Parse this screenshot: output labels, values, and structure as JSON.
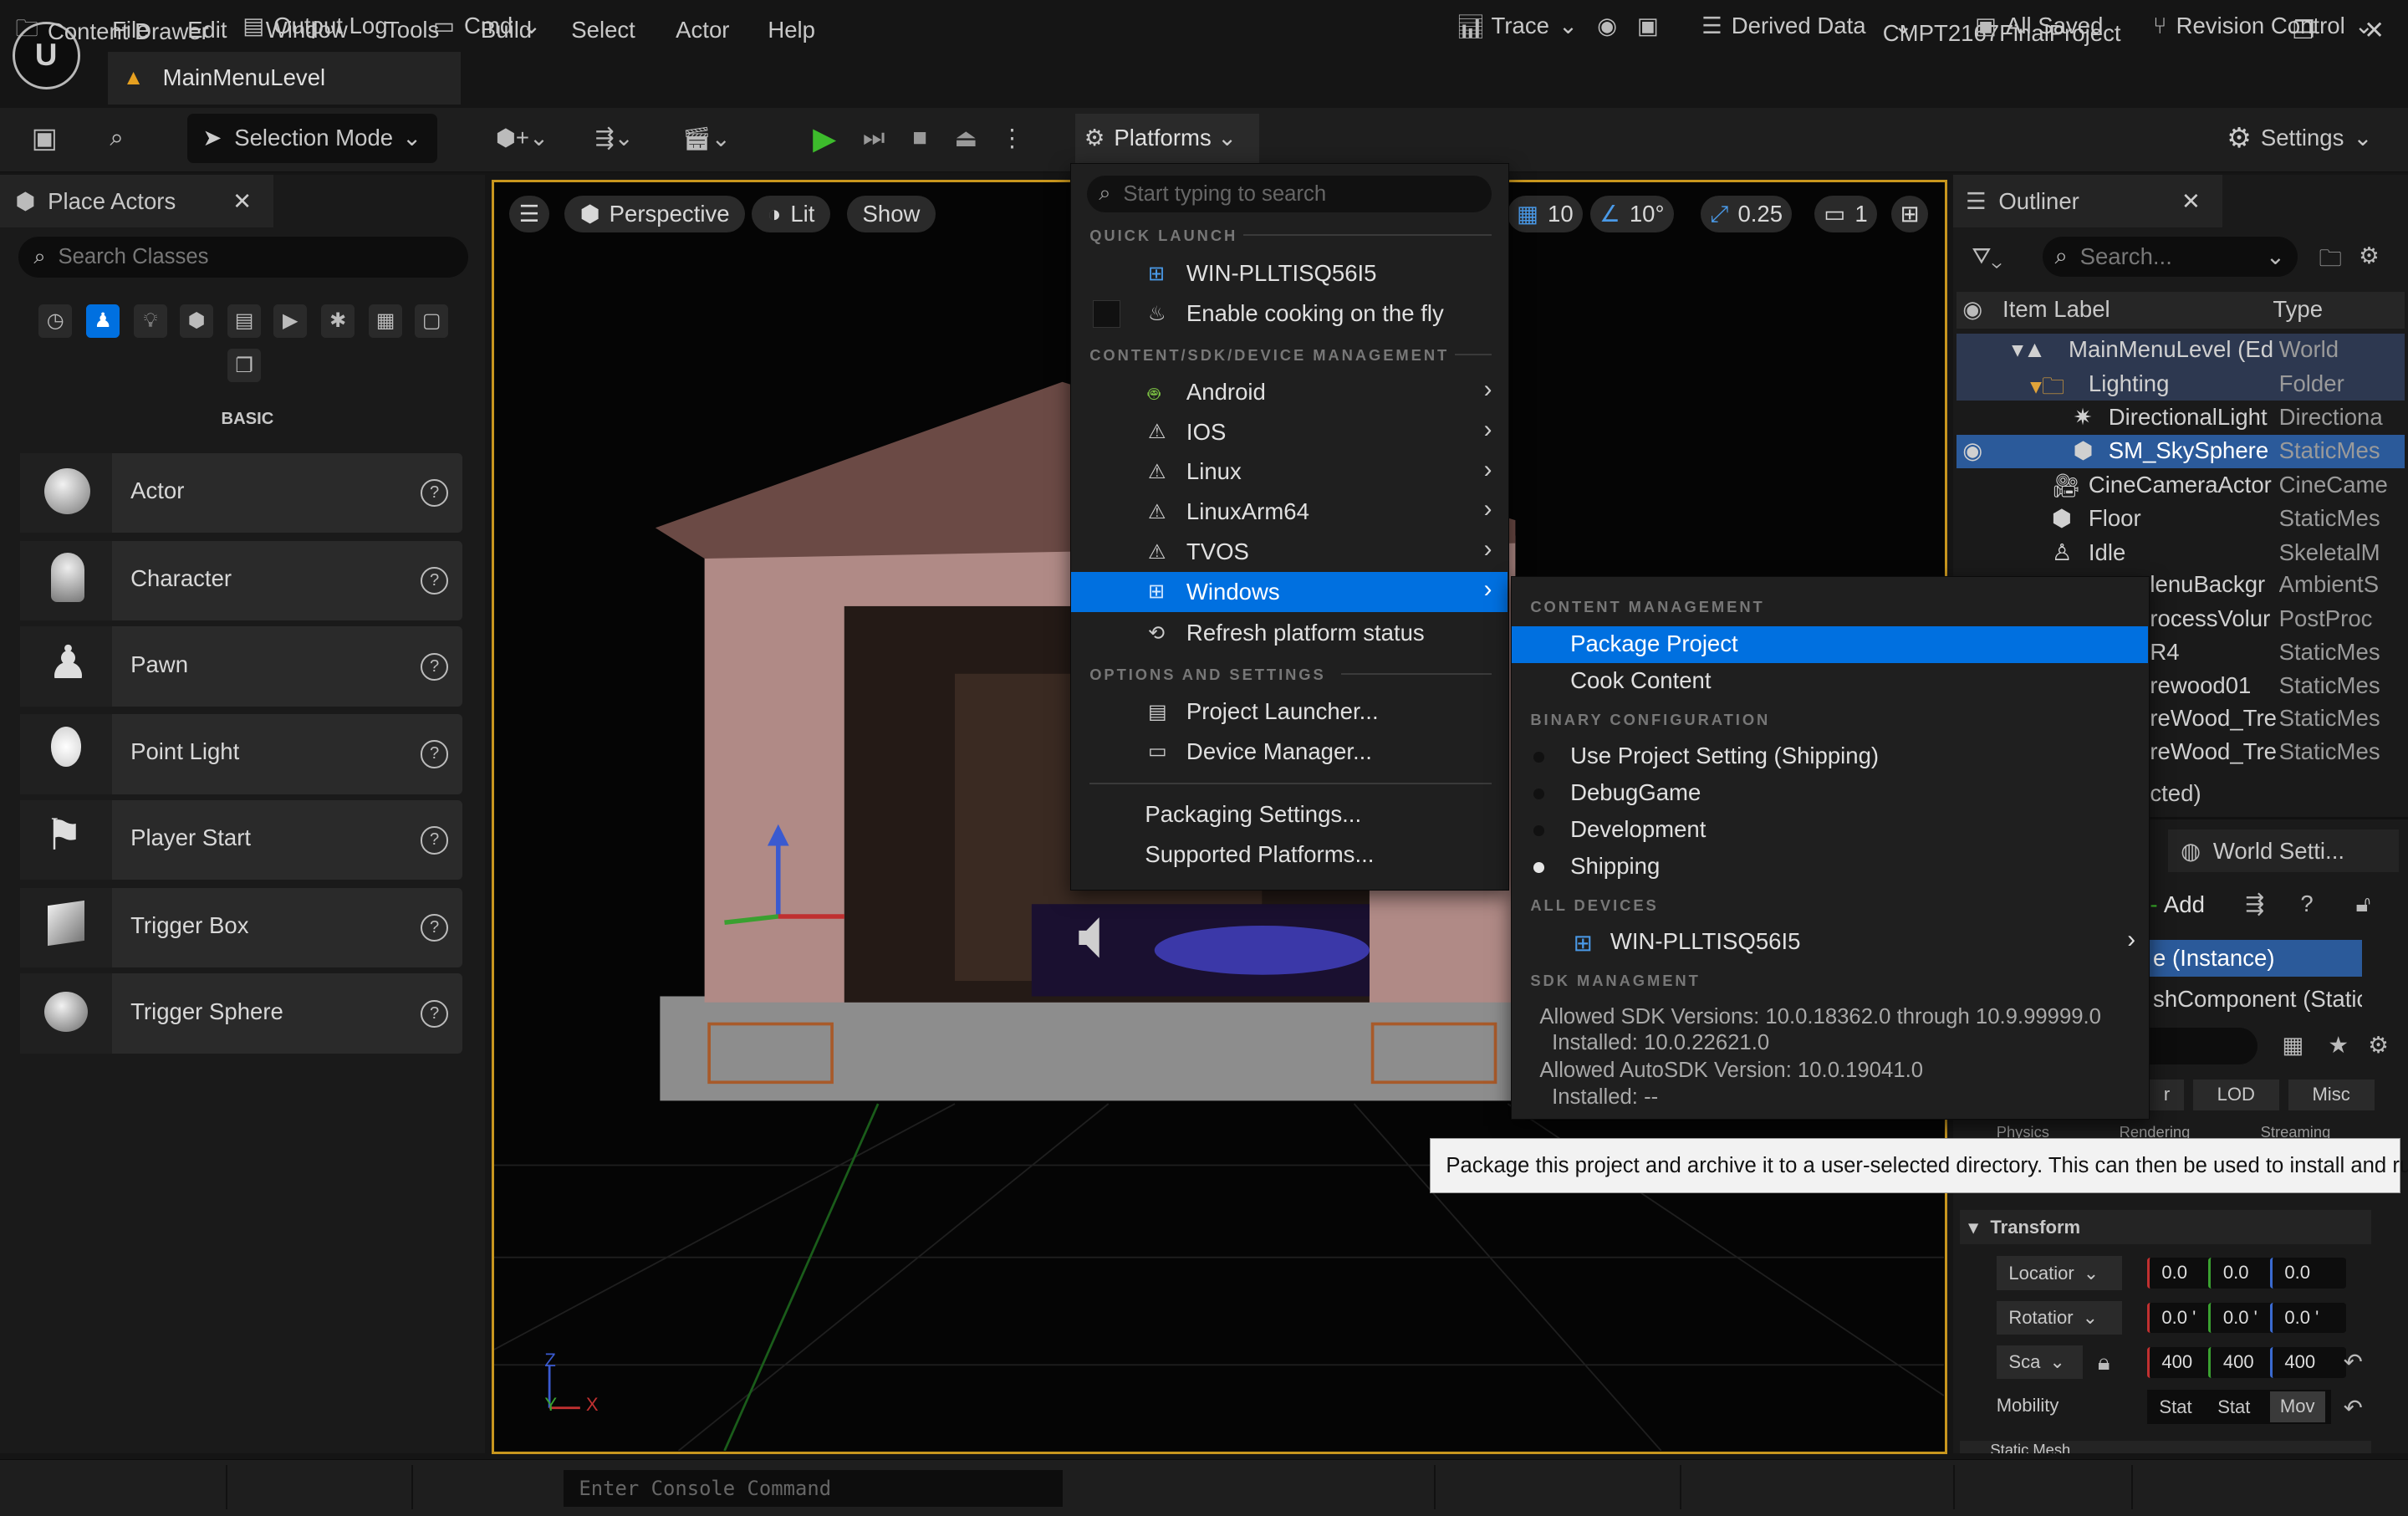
{
  "window": {
    "project_name": "CMPT2167FinalProject",
    "level_tab": "MainMenuLevel",
    "menu": [
      "File",
      "Edit",
      "Window",
      "Tools",
      "Build",
      "Select",
      "Actor",
      "Help"
    ]
  },
  "toolbar": {
    "selection_mode": "Selection Mode",
    "platforms": "Platforms",
    "settings": "Settings"
  },
  "place_actors": {
    "title": "Place Actors",
    "search_placeholder": "Search Classes",
    "category": "BASIC",
    "items": [
      "Actor",
      "Character",
      "Pawn",
      "Point Light",
      "Player Start",
      "Trigger Box",
      "Trigger Sphere"
    ]
  },
  "viewport": {
    "perspective": "Perspective",
    "lit": "Lit",
    "show": "Show",
    "grid_size": "10",
    "rotation_snap": "10°",
    "scale_snap": "0.25",
    "camera_speed": "1",
    "axis_x": "X",
    "axis_y": "Y",
    "axis_z": "Z"
  },
  "outliner": {
    "title": "Outliner",
    "search_placeholder": "Search...",
    "col_label": "Item Label",
    "col_type": "Type",
    "rows": [
      {
        "label": "MainMenuLevel (Ed",
        "type": "World"
      },
      {
        "label": "Lighting",
        "type": "Folder"
      },
      {
        "label": "DirectionalLight",
        "type": "Directiona"
      },
      {
        "label": "SM_SkySphere",
        "type": "StaticMes"
      },
      {
        "label": "CineCameraActor",
        "type": "CineCame"
      },
      {
        "label": "Floor",
        "type": "StaticMes"
      },
      {
        "label": "Idle",
        "type": "SkeletalM"
      },
      {
        "label": "lenuBackgr",
        "type": "AmbientS"
      },
      {
        "label": "rocessVolur",
        "type": "PostProc"
      },
      {
        "label": "R4",
        "type": "StaticMes"
      },
      {
        "label": "rewood01",
        "type": "StaticMes"
      },
      {
        "label": "reWood_Tre",
        "type": "StaticMes"
      },
      {
        "label": "reWood_Tre",
        "type": "StaticMes"
      }
    ],
    "selected_suffix": "cted)"
  },
  "details": {
    "world_settings": "World Setti...",
    "add": "Add",
    "instance": "e (Instance)",
    "component": "shComponent (Static",
    "filter_tabs": [
      "r",
      "LOD",
      "Misc"
    ],
    "filter_tabs_row2": [
      "Physics",
      "Rendering",
      "Streaming"
    ],
    "transform": "Transform",
    "location_label": "Locatior",
    "rotation_label": "Rotatior",
    "scale_label": "Sca",
    "location": [
      "0.0",
      "0.0",
      "0.0"
    ],
    "rotation": [
      "0.0 '",
      "0.0 '",
      "0.0 '"
    ],
    "scale": [
      "400",
      "400",
      "400"
    ],
    "mobility_label": "Mobility",
    "mobility_options": [
      "Stat",
      "Stat",
      "Mov"
    ],
    "static_mesh_section": "Static Mesh"
  },
  "platforms_menu": {
    "search_placeholder": "Start typing to search",
    "sec_quick_launch": "QUICK LAUNCH",
    "quick_launch_device": "WIN-PLLTISQ56I5",
    "enable_cooking": "Enable cooking on the fly",
    "sec_content": "CONTENT/SDK/DEVICE MANAGEMENT",
    "platforms": [
      "Android",
      "IOS",
      "Linux",
      "LinuxArm64",
      "TVOS",
      "Windows"
    ],
    "refresh": "Refresh platform status",
    "sec_options": "OPTIONS AND SETTINGS",
    "project_launcher": "Project Launcher...",
    "device_manager": "Device Manager...",
    "packaging_settings": "Packaging Settings...",
    "supported_platforms": "Supported Platforms..."
  },
  "windows_submenu": {
    "sec_content": "CONTENT MANAGEMENT",
    "package_project": "Package Project",
    "cook_content": "Cook Content",
    "sec_binary": "BINARY CONFIGURATION",
    "configs": [
      "Use Project Setting (Shipping)",
      "DebugGame",
      "Development",
      "Shipping"
    ],
    "selected_config_index": 3,
    "sec_devices": "ALL DEVICES",
    "device": "WIN-PLLTISQ56I5",
    "sec_sdk": "SDK MANAGMENT",
    "sdk_allowed": "Allowed SDK Versions: 10.0.18362.0 through 10.9.99999.0",
    "sdk_installed": "Installed: 10.0.22621.0",
    "autosdk_allowed": "Allowed AutoSDK Version: 10.0.19041.0",
    "autosdk_installed": "Installed: --"
  },
  "tooltip": "Package this project and archive it to a user-selected directory. This can then be used to install and run.",
  "statusbar": {
    "content_drawer": "Content Drawer",
    "output_log": "Output Log",
    "cmd": "Cmd",
    "console_placeholder": "Enter Console Command",
    "trace": "Trace",
    "derived_data": "Derived Data",
    "all_saved": "All Saved",
    "revision_control": "Revision Control"
  },
  "colors": {
    "accent": "#0070e0",
    "viewport_border": "#c8961e",
    "play_green": "#3dbb2c"
  }
}
